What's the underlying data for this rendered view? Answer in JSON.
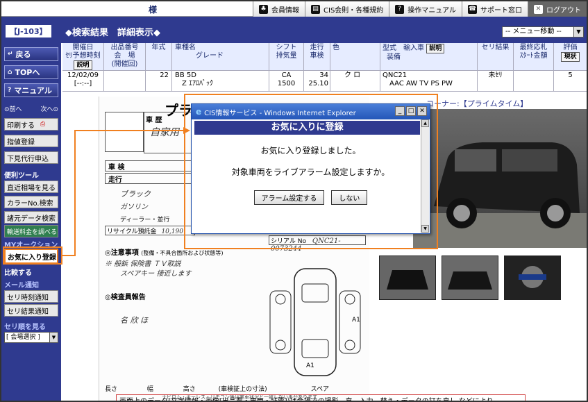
{
  "header": {
    "title": "様",
    "nav": [
      {
        "label": "会員情報",
        "icon": "house-icon",
        "glyph": "♣"
      },
      {
        "label": "CIS会則・各種規約",
        "icon": "document-icon",
        "glyph": "▤"
      },
      {
        "label": "操作マニュアル",
        "icon": "question-icon",
        "glyph": "?"
      },
      {
        "label": "サポート窓口",
        "icon": "phone-icon",
        "glyph": "☎"
      },
      {
        "label": "ログアウト",
        "icon": "close-icon",
        "glyph": "✕"
      }
    ]
  },
  "subheader": {
    "code": "【J-103】",
    "breadcrumb": "◆検索結果　詳細表示◆",
    "menu_select": "-- メニュー移動 --"
  },
  "sidebar": {
    "back": "戻る",
    "top": "TOPへ",
    "manual": "マニュアル",
    "prev": "⊙前へ",
    "next": "次へ⊙",
    "print": "印刷する",
    "bid": "指値登録",
    "preview": "下見代行申込",
    "tools_label": "便利ツール",
    "market": "直近相場を見る",
    "color": "カラーNo.検索",
    "spec": "諸元データ検索",
    "shipping": "輸送料金を調べる",
    "my_auction": "MYオークション",
    "favorite": "お気に入り登録",
    "compare": "比較する",
    "mail_label": "メール通知",
    "sale_time": "セリ時刻通知",
    "sale_result": "セリ結果通知",
    "order_label": "セリ順を見る",
    "venue_select": "[ 会場選択 ]"
  },
  "table": {
    "headers": {
      "date": "開催日",
      "date2": "ｾﾘ予想時刻",
      "lot": "出品番号",
      "lot2": "会　場",
      "lot3": "(開催回)",
      "year": "年式",
      "car": "車種名",
      "grade": "グレード",
      "shift": "シフト",
      "disp": "排気量",
      "mileage": "走行",
      "inspect": "車検",
      "color": "色",
      "model": "型式",
      "equip": "装備",
      "import": "輸入車",
      "result": "セリ結果",
      "final": "最終応札",
      "start": "ｽﾀｰﾄ金額",
      "rating": "評価"
    },
    "explain_btn": "説明",
    "ref_btn": "現状",
    "row": {
      "date": "12/02/09",
      "time": "[--:--]",
      "year": "22",
      "car": "BB  5D",
      "grade": "Z ｴｱﾛﾊﾟｯｸ",
      "shift": "CA",
      "disp": "1500",
      "mileage": "34",
      "inspect": "25.10",
      "color": "ク ロ",
      "model": "QNC21",
      "equip": "AAC AW TV PS PW",
      "result": "未ｾﾘ",
      "rating": "5"
    }
  },
  "sheet": {
    "title": "プライムターミナ",
    "corner": "コーナー:【プライムタイム】",
    "history": "車 歴",
    "inspection": "車 検",
    "mileage": "走行",
    "recycle": "リサイクル預託金",
    "recycle_val": "10,190",
    "notes_label": "◎注意事項",
    "notes_sub": "(整備・不具合箇所および状態等)",
    "inspector": "◎検査員報告",
    "handwrite1": "自家用",
    "handwrite2": "ブラック",
    "handwrite3": "ガソリン",
    "handwrite4": "ディーラー・並行",
    "handwrite5": "※ 般鋲 保険書 ＴＶ取説",
    "handwrite6": "スペアキー 接近します",
    "handwrite7": "QNC21-0073244",
    "serial_label": "シリアル No",
    "length": "長さ",
    "width": "幅",
    "height": "高さ",
    "size_note": "(車検証上の寸法)",
    "spare": "スペア",
    "small_note": "ナビロム・キーレス・リモコン等は実車状況と一致しない事があります"
  },
  "footer": {
    "note": "画面上のデータ(文字情報・画像[出品票・車両・証票])は会場での撮影、直、入力、替え・データの打ち直し などにより"
  },
  "dialog": {
    "window_title": "CIS情報サービス - Windows Internet Explorer",
    "heading": "お気に入りに登録",
    "message1": "お気に入り登録しました。",
    "message2": "対象車両をライブアラーム設定しますか。",
    "alarm_btn": "アラーム設定する",
    "no_btn": "しない"
  }
}
